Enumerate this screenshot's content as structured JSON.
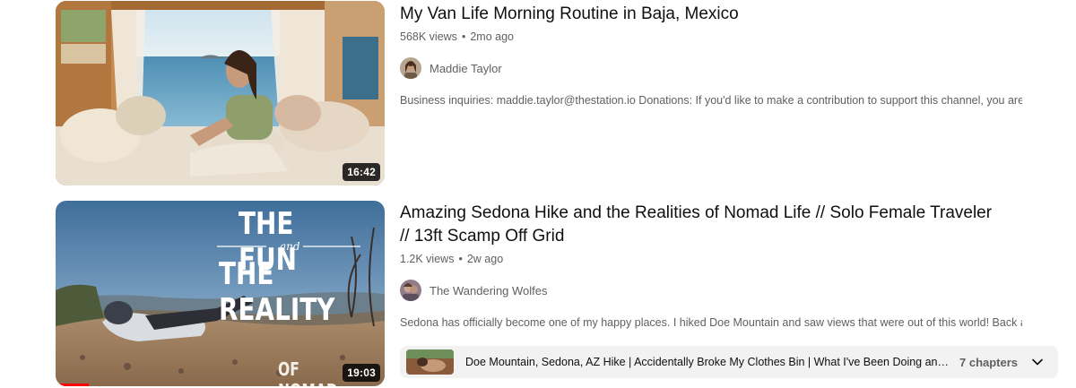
{
  "videos": [
    {
      "title": "My Van Life Morning Routine in Baja, Mexico",
      "views": "568K views",
      "age": "2mo ago",
      "channel": "Maddie Taylor",
      "snippet": "Business inquiries: maddie.taylor@thestation.io Donations: If you'd like to make a contribution to support this channel, you are ...",
      "duration": "16:42",
      "thumbnail_icon": "van-interior-thumbnail",
      "avatar_icon": "channel-avatar"
    },
    {
      "title": "Amazing Sedona Hike and the Realities of Nomad Life // Solo Female Traveler // 13ft Scamp Off Grid",
      "views": "1.2K views",
      "age": "2w ago",
      "channel": "The Wandering Wolfes",
      "snippet": "Sedona has officially become one of my happy places. I hiked Doe Mountain and saw views that were out of this world! Back at ...",
      "duration": "19:03",
      "thumbnail_text": {
        "line1": "THE FUN",
        "and": "and",
        "line2": "THE REALITY",
        "bottom": "OF NOMAD"
      },
      "watch_progress": 0.1,
      "chapters": {
        "first_chapter": "Doe Mountain, Sedona, AZ Hike | Accidentally Broke My Clothes Bin | What I've Been Doing and the Realities",
        "count": "7 chapters",
        "expand_icon": "chevron-down-icon"
      }
    }
  ],
  "colors": {
    "title": "#0f0f0f",
    "meta": "#606060",
    "chapters_bg": "#f2f2f2",
    "progress": "#ff0000"
  }
}
